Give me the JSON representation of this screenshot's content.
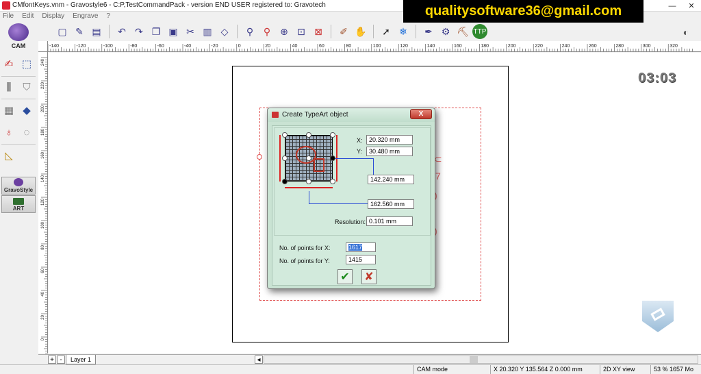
{
  "window": {
    "title": "CMfontKeys.vnm - Gravostyle6 - C:P,TestCommandPack - version END USER registered to: Gravotech",
    "minimize_glyph": "—",
    "close_glyph": "✕"
  },
  "watermark": "qualitysoftware36@gmail.com",
  "menu": {
    "items": [
      "File",
      "Edit",
      "Display",
      "Engrave",
      "?"
    ]
  },
  "logo": {
    "label": "CAM"
  },
  "toolbar": {
    "icons": [
      "new-page-icon",
      "pencil-icon",
      "save-icon",
      "undo-icon",
      "redo-icon",
      "copy-icon",
      "paste-icon",
      "cut-icon",
      "clipboard-icon",
      "eraser-icon",
      "zoom-in-icon",
      "zoom-red-icon",
      "zoom-fit-icon",
      "zoom-page-icon",
      "zoom-selection-icon",
      "brush-icon",
      "hand-icon",
      "select-arrow-icon",
      "snowflake-icon",
      "tool-icon",
      "machine-icon",
      "engrave-icon",
      "ttp-icon"
    ]
  },
  "left_modes": {
    "gravostyle": "GravoStyle",
    "art": "ART"
  },
  "ruler": {
    "top_labels": [
      "-140",
      "-120",
      "-100",
      "-80",
      "-60",
      "-40",
      "-20",
      "0",
      "20",
      "40",
      "60",
      "80",
      "100",
      "120",
      "140",
      "160",
      "180",
      "200",
      "220",
      "240",
      "260",
      "280",
      "300",
      "320"
    ],
    "left_labels": [
      "240",
      "220",
      "200",
      "180",
      "160",
      "140",
      "120",
      "100",
      "80",
      "60",
      "40",
      "20",
      "0"
    ]
  },
  "clock": "03:03",
  "dialog": {
    "title": "Create TypeArt object",
    "close_label": "X",
    "x_label": "X:",
    "x_value": "20.320 mm",
    "y_label": "Y:",
    "y_value": "30.480 mm",
    "width_value": "142.240 mm",
    "height_value": "162.560 mm",
    "resolution_label": "Resolution:",
    "resolution_value": "0.101 mm",
    "points_x_label": "No. of points for X:",
    "points_x_value": "1617",
    "points_y_label": "No. of points for Y:",
    "points_y_value": "1415",
    "ok_glyph": "✔",
    "cancel_glyph": "✘"
  },
  "layerbar": {
    "add": "+",
    "remove": "-",
    "layer_name": "Layer 1",
    "nav": "◂"
  },
  "status": {
    "mode": "CAM mode",
    "coords": "X 20.320   Y 135.564   Z 0.000 mm",
    "view": "2D XY view",
    "zoom": "53 % 1657 Mo"
  },
  "colors": {
    "dialog_bg": "#c9e3d3",
    "selection": "#e05050",
    "watermark_text": "#ffd800",
    "accent_blue": "#2a4bd6"
  }
}
